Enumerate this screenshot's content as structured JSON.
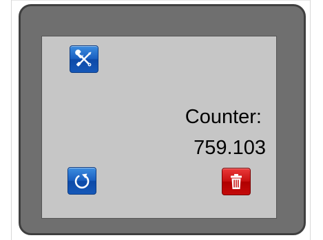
{
  "counter": {
    "label": "Counter:",
    "value": "759.103"
  },
  "buttons": {
    "settings": {
      "icon": "wrench-screwdriver-icon",
      "color": "#1a5fc0"
    },
    "reset": {
      "icon": "refresh-icon",
      "color": "#1a5fc0"
    },
    "delete": {
      "icon": "trash-icon",
      "color": "#c81111"
    }
  },
  "colors": {
    "bezel": "#6f6f6f",
    "screen": "#c6c6c6"
  }
}
